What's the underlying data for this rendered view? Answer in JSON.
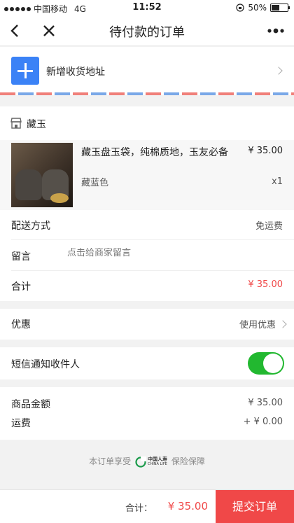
{
  "status_bar": {
    "carrier": "中国移动",
    "network": "4G",
    "time": "11:52",
    "battery": "50%"
  },
  "nav": {
    "title": "待付款的订单"
  },
  "address": {
    "add_label": "新增收货地址"
  },
  "shop": {
    "name": "藏玉"
  },
  "product": {
    "title": "藏玉盘玉袋，纯棉质地，玉友必备",
    "sku": "藏蓝色",
    "price": "¥ 35.00",
    "quantity": "x1"
  },
  "delivery": {
    "label": "配送方式",
    "value": "免运费"
  },
  "message": {
    "label": "留言",
    "placeholder": "点击给商家留言"
  },
  "subtotal": {
    "label": "合计",
    "value": "¥ 35.00"
  },
  "discount": {
    "label": "优惠",
    "value": "使用优惠"
  },
  "sms": {
    "label": "短信通知收件人",
    "enabled": true
  },
  "summary": {
    "goods_label": "商品金额",
    "goods_value": "¥ 35.00",
    "freight_label": "运费",
    "freight_value": "+ ¥ 0.00"
  },
  "insurance": {
    "prefix": "本订单享受",
    "brand_cn": "中国人寿",
    "brand_en": "CHINA LIFE",
    "suffix": "保险保障"
  },
  "bottom": {
    "total_label": "合计：",
    "total_value": "¥ 35.00",
    "submit_label": "提交订单"
  },
  "colors": {
    "accent_red": "#f04848",
    "blue": "#3b82f6",
    "toggle_green": "#22b830"
  }
}
